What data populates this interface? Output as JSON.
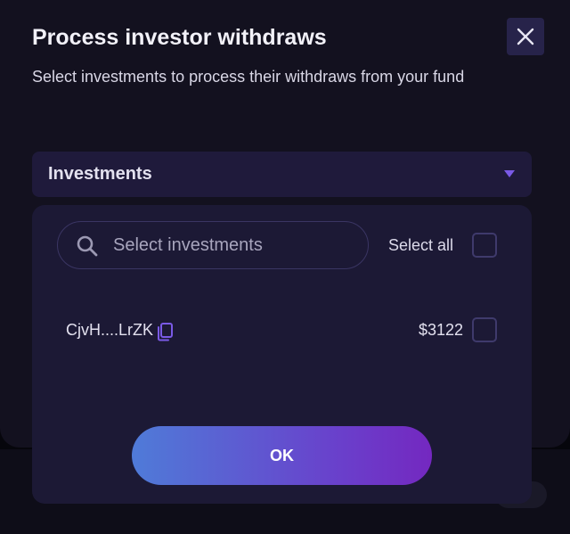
{
  "modal": {
    "title": "Process investor withdraws",
    "subtitle": "Select investments to process their withdraws from your fund",
    "close_icon": "close-icon"
  },
  "investments_select": {
    "label": "Investments",
    "caret_icon": "caret-down-icon"
  },
  "dropdown": {
    "search": {
      "placeholder": "Select investments",
      "icon": "search-icon"
    },
    "select_all_label": "Select all",
    "select_all_checked": false,
    "items": [
      {
        "name": "CjvH....LrZK",
        "amount": "$3122",
        "checked": false,
        "copy_icon": "copy-icon"
      }
    ],
    "ok_label": "OK"
  },
  "colors": {
    "modal_bg": "#13111f",
    "accent": "#7a5ae6",
    "button_gradient_start": "#4f7bd8",
    "button_gradient_end": "#7428c0"
  }
}
